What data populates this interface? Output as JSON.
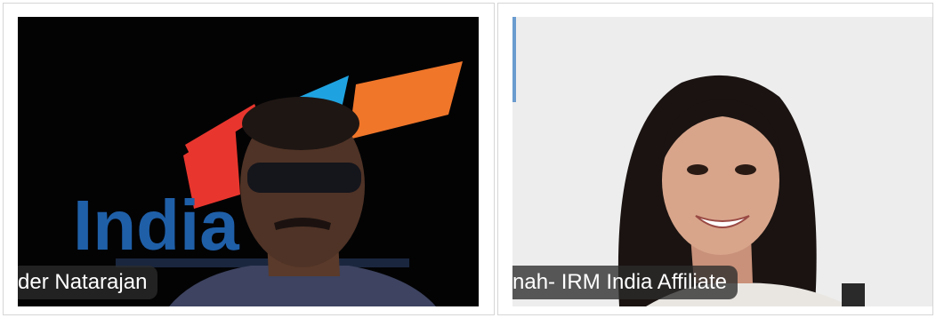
{
  "participants": [
    {
      "display_name": "der Natarajan",
      "background_brand_text": "India  st"
    },
    {
      "display_name": "nah-  IRM India Affiliate"
    }
  ],
  "colors": {
    "page_bg": "#ffffff",
    "cell_border": "#d6d6d6",
    "name_tag_bg": "#2c2c2c",
    "logo_blue": "#1f5fa8",
    "logo_red": "#e8362e",
    "logo_cyan": "#1fa3e0",
    "logo_orange": "#f0762a"
  }
}
